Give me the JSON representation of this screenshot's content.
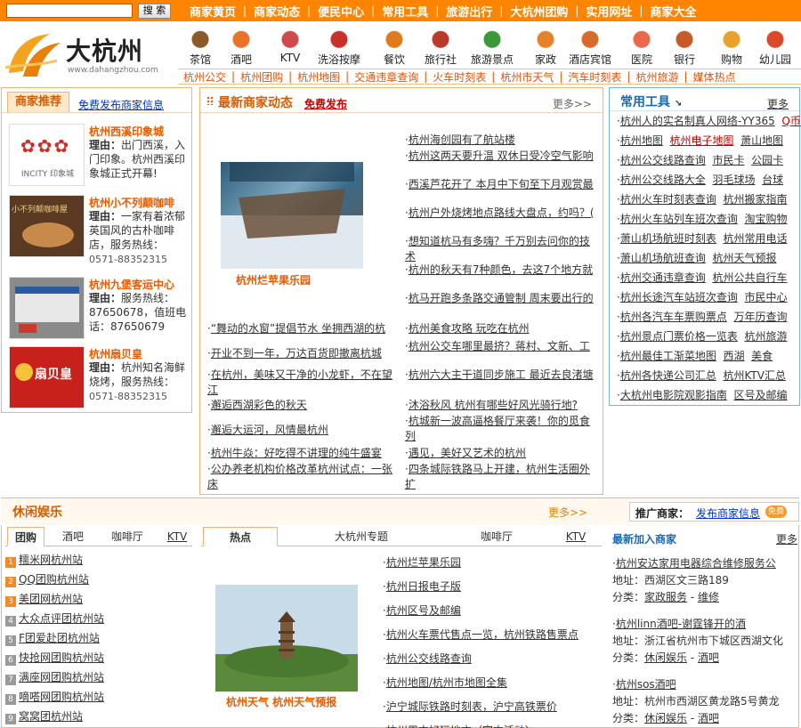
{
  "search": {
    "placeholder": "",
    "button": "搜 索"
  },
  "topnav": [
    "商家黄页",
    "商家动态",
    "便民中心",
    "常用工具",
    "旅游出行",
    "大杭州团购",
    "实用网址",
    "商家大全"
  ],
  "logo": {
    "title": "大杭州",
    "url": "www.dahangzhou.com"
  },
  "categories": [
    {
      "label": "茶馆",
      "icon": "teapot-icon",
      "color": "#8a5a2a"
    },
    {
      "label": "酒吧",
      "icon": "drink-icon",
      "color": "#e8742a"
    },
    {
      "label": "KTV",
      "icon": "microphone-icon",
      "color": "#d04a4a"
    },
    {
      "label": "洗浴按摩",
      "icon": "bath-icon",
      "color": "#c8302a"
    },
    {
      "label": "餐饮",
      "icon": "bowl-icon",
      "color": "#e07a20"
    },
    {
      "label": "旅行社",
      "icon": "suitcase-icon",
      "color": "#b83a2a"
    },
    {
      "label": "旅游景点",
      "icon": "scenic-icon",
      "color": "#3a9a3a"
    },
    {
      "label": "家政",
      "icon": "cleaning-icon",
      "color": "#e8822a"
    },
    {
      "label": "酒店宾馆",
      "icon": "hotel-icon",
      "color": "#d86a2a"
    },
    {
      "label": "医院",
      "icon": "medical-cross-icon",
      "color": "#e86a4a"
    },
    {
      "label": "银行",
      "icon": "bank-icon",
      "color": "#c85a2a"
    },
    {
      "label": "购物",
      "icon": "shopping-basket-icon",
      "color": "#e8a22a"
    },
    {
      "label": "幼儿园",
      "icon": "kindergarten-icon",
      "color": "#d84a2a"
    }
  ],
  "sublinks": [
    "杭州公交",
    "杭州团购",
    "杭州地图",
    "交通违章查询",
    "火车时刻表",
    "杭州市天气",
    "汽车时刻表",
    "杭州旅游",
    "媒体热点"
  ],
  "recommend": {
    "tab": "商家推荐",
    "link": "免费发布商家信息",
    "items": [
      {
        "name": "杭州西溪印象城",
        "label": "理由：",
        "desc": "出门西溪，入门印象。杭州西溪印象城正式开幕!",
        "tel": "",
        "img_text": "INCITY 印象城"
      },
      {
        "name": "杭州小不列颠咖啡",
        "label": "理由：",
        "desc": "一家有着浓郁英国风的古朴咖啡店，服务热线：",
        "tel": "0571-88352315",
        "img_text": "小不列颠咖啡屋"
      },
      {
        "name": "杭州九堡客运中心",
        "label": "理由：",
        "desc": "服务热线：87650678，值班电话：87650679",
        "tel": "",
        "img_text": ""
      },
      {
        "name": "杭州扇贝皇",
        "label": "理由：",
        "desc": "杭州知名海鲜烧烤，服务热线：",
        "tel": "0571-88352315",
        "img_text": "扇贝皇"
      }
    ]
  },
  "news": {
    "title": "最新商家动态",
    "sub": "免费发布",
    "more": "更多>>",
    "image_caption": "杭州烂苹果乐园",
    "right": [
      "杭州海创园有了航站楼",
      "杭州这两天要升温 双休日受冷空气影响",
      "西溪芦花开了 本月中下旬至下月观赏最",
      "杭州户外烧烤地点路线大盘点，约吗？(",
      "想知道杭马有多嗨？千万别去问你的技术",
      "杭州的秋天有7种颜色，去这7个地方就",
      "杭马开跑多条路交通管制 周末要出行的",
      "杭州美食攻略 玩吃在杭州",
      "杭州公交车哪里最挤？蒋村、文新、工",
      "杭州六大主干道同步施工 最近去良渚塘",
      "沐浴秋风 杭州有哪些好风光骑行地?",
      "杭城新一波高逼格餐厅来袭！你的觅食列",
      "遇见，美好又艺术的杭州",
      "四条城际铁路马上开建，杭州生活圈外扩"
    ],
    "left": [
      "“舞动的水窗”提倡节水 坐拥西湖的杭",
      "开业不到一年，万达百货即撤离杭城",
      "在杭州，美味又干净的小龙虾，不在望江",
      "邂逅西湖彩色的秋天",
      "邂逅大运河，风情最杭州",
      "杭州牛焱：好吃得不讲理的纯牛盛宴",
      "公办养老机构价格改革杭州试点：一张床"
    ]
  },
  "tools": {
    "title": "常用工具",
    "more": "更多",
    "rows": [
      [
        {
          "t": "杭州人的实名制真人网络-YY365",
          "s": "a"
        },
        {
          "t": "Q币",
          "s": "red"
        }
      ],
      [
        {
          "t": "杭州地图",
          "s": "a"
        },
        {
          "t": "杭州电子地图",
          "s": "red"
        },
        {
          "t": "萧山地图",
          "s": "a"
        }
      ],
      [
        {
          "t": "杭州公交线路查询",
          "s": "a"
        },
        {
          "t": "市民卡",
          "s": "a"
        },
        {
          "t": "公园卡",
          "s": "a"
        }
      ],
      [
        {
          "t": "杭州公交线路大全",
          "s": "a"
        },
        {
          "t": "羽毛球场",
          "s": "a"
        },
        {
          "t": "台球",
          "s": "a"
        }
      ],
      [
        {
          "t": "杭州火车时刻表查询",
          "s": "a"
        },
        {
          "t": "杭州搬家指南",
          "s": "a"
        }
      ],
      [
        {
          "t": "杭州火车站列车班次查询",
          "s": "a"
        },
        {
          "t": "淘宝购物",
          "s": "a"
        }
      ],
      [
        {
          "t": "萧山机场航班时刻表",
          "s": "a"
        },
        {
          "t": "杭州常用电话",
          "s": "a"
        }
      ],
      [
        {
          "t": "萧山机场航班查询",
          "s": "a"
        },
        {
          "t": "杭州天气预报",
          "s": "a"
        }
      ],
      [
        {
          "t": "杭州交通违章查询",
          "s": "a"
        },
        {
          "t": "杭州公共自行车",
          "s": "a"
        }
      ],
      [
        {
          "t": "杭州长途汽车站班次查询",
          "s": "a"
        },
        {
          "t": "市民中心",
          "s": "a"
        }
      ],
      [
        {
          "t": "杭州各汽车车票购票点",
          "s": "a"
        },
        {
          "t": "万年历查询",
          "s": "a"
        }
      ],
      [
        {
          "t": "杭州景点门票价格一览表",
          "s": "a"
        },
        {
          "t": "杭州旅游",
          "s": "a"
        }
      ],
      [
        {
          "t": "杭州最佳工渐菜地图",
          "s": "a"
        },
        {
          "t": "西湖",
          "s": "a"
        },
        {
          "t": "美食",
          "s": "a"
        }
      ],
      [
        {
          "t": "杭州各快递公司汇总",
          "s": "a"
        },
        {
          "t": "杭州KTV汇总",
          "s": "a"
        }
      ],
      [
        {
          "t": "大杭州电影院观影指南",
          "s": "a"
        },
        {
          "t": "区号及邮编",
          "s": "a"
        }
      ]
    ]
  },
  "leisure": {
    "title": "休闲娱乐",
    "more": "更多>>",
    "promo_label": "推广商家：",
    "promo_link": "发布商家信息",
    "promo_badge": "免费",
    "group_tabs": [
      "团购",
      "酒吧",
      "咖啡厅",
      "KTV"
    ],
    "group_links": [
      "糯米网杭州站",
      "QQ团购杭州站",
      "美团网杭州站",
      "大众点评团杭州站",
      "F团爱赴团杭州站",
      "快抢网团购杭州站",
      "满座网团购杭州站",
      "嘀嗒网团购杭州站",
      "窝窝团杭州站"
    ],
    "hot_tabs": [
      "热点",
      "大杭州专题",
      "咖啡厅",
      "KTV"
    ],
    "hot_caption": "杭州天气  杭州天气预报",
    "hot_links": [
      "杭州烂苹果乐园",
      "杭州日报电子版",
      "杭州区号及邮编",
      "杭州火车票代售点一览，杭州铁路售票点",
      "杭州公交线路查询",
      "杭州地图/杭州市地图全集",
      "沪宁城际铁路时刻表，沪宁高铁票价",
      "杭州周末好玩地方（室内活动）"
    ],
    "new_title": "最新加入商家",
    "new_more": "更多",
    "new_items": [
      {
        "name": "杭州安达家用电器综合维修服务公",
        "addr_label": "地址：",
        "addr": "西湖区文三路189",
        "cat_label": "分类：",
        "cat1": "家政服务",
        "cat2": "维修"
      },
      {
        "name": "杭州linn酒吧-谢霆锋开的酒",
        "addr_label": "地址：",
        "addr": "浙江省杭州市下城区西湖文化",
        "cat_label": "分类：",
        "cat1": "休闲娱乐",
        "cat2": "酒吧"
      },
      {
        "name": "杭州sos酒吧",
        "addr_label": "地址：",
        "addr": "杭州市西湖区黄龙路5号黄龙",
        "cat_label": "分类：",
        "cat1": "休闲娱乐",
        "cat2": "酒吧"
      }
    ]
  },
  "colors": {
    "accent": "#ff8400",
    "title": "#d95b00",
    "link_blue": "#0033cc",
    "tool_blue": "#1a6bb3"
  }
}
